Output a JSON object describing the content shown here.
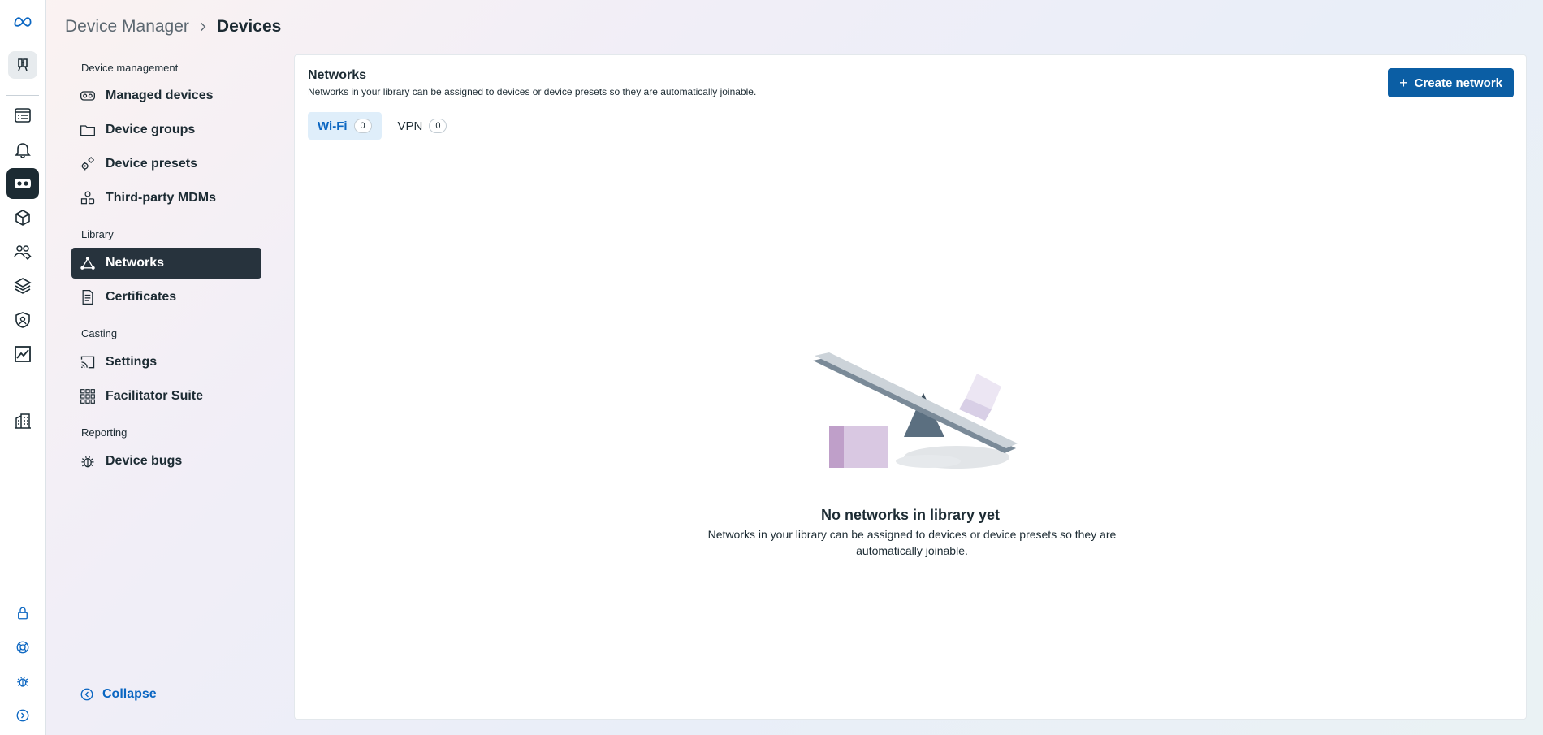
{
  "breadcrumb": {
    "parent": "Device Manager",
    "current": "Devices"
  },
  "rail": {
    "items": [
      "meta-logo-icon",
      "pin-icon",
      "dashboard-icon",
      "notifications-icon",
      "devices-icon",
      "apps-icon",
      "users-icon",
      "layers-icon",
      "security-icon",
      "analytics-icon",
      "organization-icon"
    ],
    "bottom": [
      "lock-icon",
      "help-icon",
      "bug-icon",
      "expand-icon"
    ]
  },
  "sidebar": {
    "section_device_management": "Device management",
    "managed_devices": "Managed devices",
    "device_groups": "Device groups",
    "device_presets": "Device presets",
    "third_party_mdms": "Third-party MDMs",
    "section_library": "Library",
    "networks": "Networks",
    "certificates": "Certificates",
    "section_casting": "Casting",
    "settings": "Settings",
    "facilitator_suite": "Facilitator Suite",
    "section_reporting": "Reporting",
    "device_bugs": "Device bugs",
    "collapse": "Collapse"
  },
  "main": {
    "title": "Networks",
    "subtitle": "Networks in your library can be assigned to devices or device presets so they are automatically joinable.",
    "create_button": "Create network",
    "tabs": [
      {
        "label": "Wi-Fi",
        "count": "0"
      },
      {
        "label": "VPN",
        "count": "0"
      }
    ],
    "empty_title": "No networks in library yet",
    "empty_description": "Networks in your library can be assigned to devices or device presets so they are automatically joinable."
  },
  "colors": {
    "accent": "#0a66c2",
    "button": "#0b5ea4",
    "active_nav": "#27333d"
  }
}
